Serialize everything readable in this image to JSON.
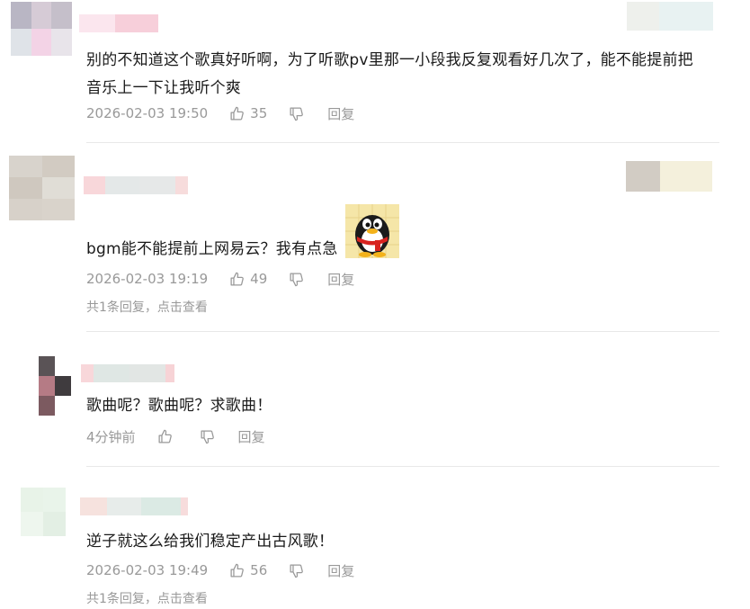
{
  "comments": [
    {
      "text_line1": "别的不知道这个歌真好听啊，为了听歌pv里那一小段我反复观看好几次了，能不能提前把",
      "text_line2": "音乐上一下让我听个爽",
      "time": "2026-02-03 19:50",
      "likes": "35",
      "reply_label": "回复"
    },
    {
      "text": "bgm能不能提前上网易云？我有点急",
      "emoji_icon": "qq-penguin-anxious",
      "time": "2026-02-03 19:19",
      "likes": "49",
      "reply_label": "回复",
      "replies_link": "共1条回复，点击查看"
    },
    {
      "text": "歌曲呢？歌曲呢？求歌曲！",
      "time": "4分钟前",
      "likes": "",
      "reply_label": "回复"
    },
    {
      "text": "逆子就这么给我们稳定产出古风歌！",
      "time": "2026-02-03 19:49",
      "likes": "56",
      "reply_label": "回复",
      "replies_link": "共1条回复，点击查看"
    }
  ],
  "icons": {
    "like": "thumbs-up-icon",
    "dislike": "thumbs-down-icon"
  },
  "colors": {
    "meta_text": "#999999",
    "divider": "#e8e8e8"
  }
}
